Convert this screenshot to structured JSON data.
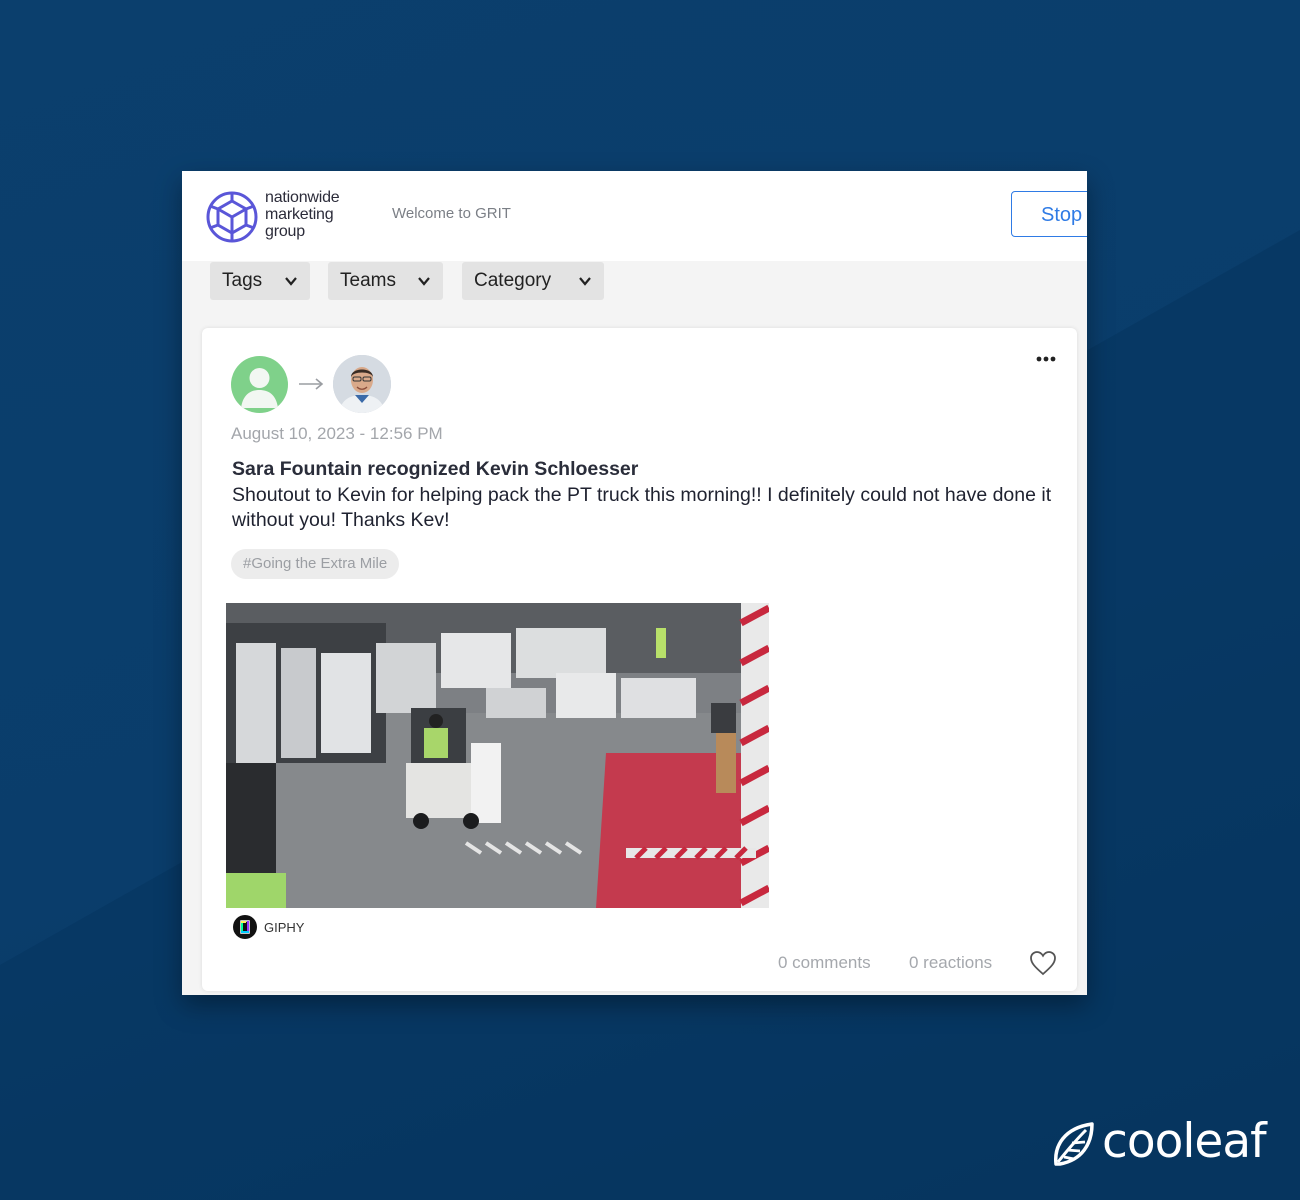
{
  "colors": {
    "background": "#0a3d6b",
    "accent_blue": "#2f7be5",
    "logo_purple": "#5a56d8",
    "heart_outline": "#555555"
  },
  "header": {
    "logo_lines": [
      "nationwide",
      "marketing",
      "group"
    ],
    "welcome_text": "Welcome to GRIT",
    "stop_button_label": "Stop"
  },
  "filters": [
    {
      "label": "Tags"
    },
    {
      "label": "Teams"
    },
    {
      "label": "Category"
    }
  ],
  "post": {
    "timestamp": "August 10, 2023 - 12:56 PM",
    "headline": "Sara Fountain recognized Kevin Schloesser",
    "message": "Shoutout to Kevin for helping pack the PT truck this morning!! I definitely could not have done it without you! Thanks Kev!",
    "tag": "#Going the Extra Mile",
    "media_source": "GIPHY",
    "comments_text": "0 comments",
    "reactions_text": "0 reactions"
  },
  "brand": {
    "name": "cooleaf"
  }
}
